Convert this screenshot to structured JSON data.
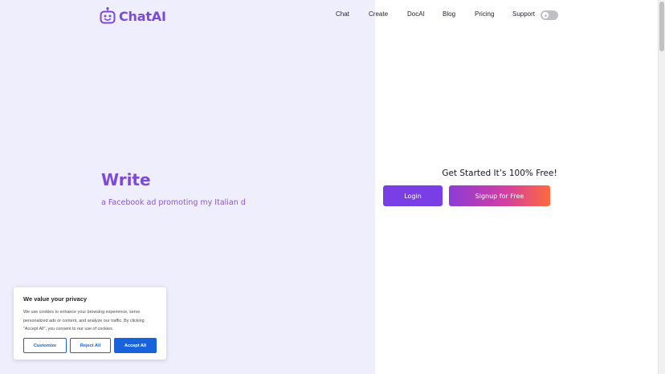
{
  "brand": {
    "name": "ChatAI",
    "color": "#7b4ad8"
  },
  "nav": {
    "items": [
      {
        "label": "Chat"
      },
      {
        "label": "Create"
      },
      {
        "label": "DocAI"
      },
      {
        "label": "Blog"
      },
      {
        "label": "Pricing"
      },
      {
        "label": "Support"
      }
    ]
  },
  "theme_toggle": {
    "icon": "sun-icon",
    "state": "off"
  },
  "hero": {
    "title": "Write",
    "subtitle": "a Facebook ad promoting my Italian d"
  },
  "cta": {
    "title": "Get Started It’s 100% Free!",
    "login_label": "Login",
    "signup_label": "Signup for Free",
    "login_color": "#7a3fe4"
  },
  "cookie": {
    "title": "We value your privacy",
    "text": "We use cookies to enhance your browsing experience, serve personalized ads or content, and analyze our traffic. By clicking \"Accept All\", you consent to our use of cookies.",
    "customize_label": "Customize",
    "reject_label": "Reject All",
    "accept_label": "Accept All",
    "accent": "#1863dc"
  }
}
